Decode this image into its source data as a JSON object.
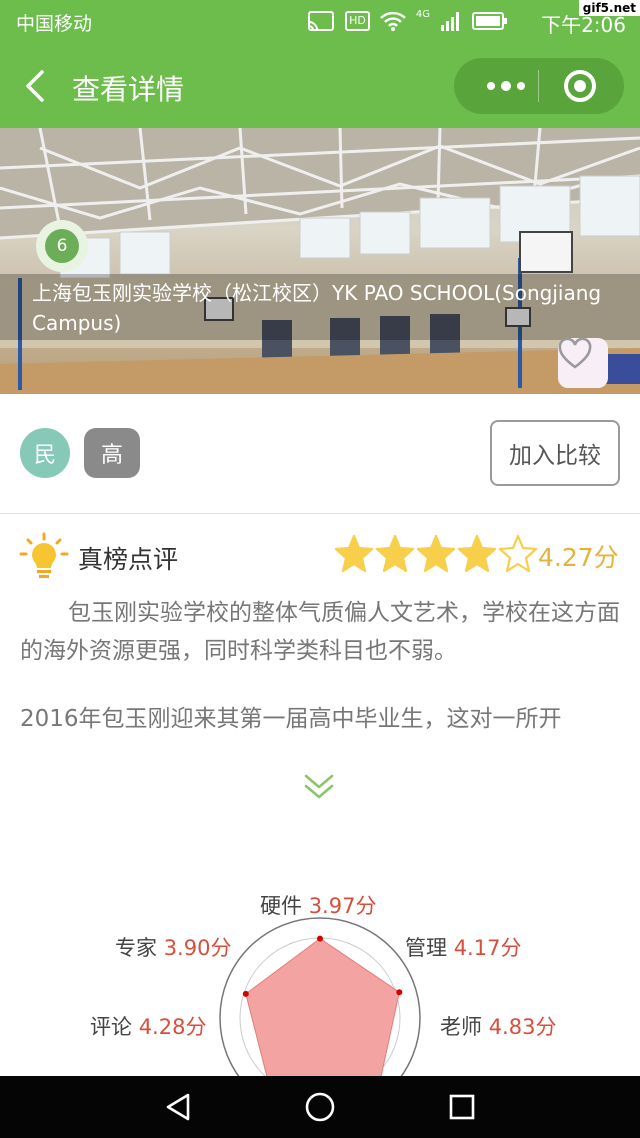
{
  "status_bar": {
    "carrier": "中国移动",
    "hd_badge": "HD",
    "signal_label": "4G",
    "time": "下午2:06",
    "watermark": "gif5.net"
  },
  "navbar": {
    "title": "查看详情",
    "back_icon": "chevron-left-icon",
    "more_icon": "more-dots-icon",
    "close_icon": "target-circle-icon"
  },
  "hero": {
    "rank": "6",
    "school_name": "上海包玉刚实验学校（松江校区）YK PAO SCHOOL(Songjiang Campus)",
    "favorite_icon": "heart-icon"
  },
  "tags": {
    "type": "民",
    "level": "高",
    "compare_label": "加入比较"
  },
  "review": {
    "title": "真榜点评",
    "rating": 4.27,
    "rating_max": 5,
    "score_text": "4.27分",
    "paragraph1": "包玉刚实验学校的整体气质偏人文艺术，学校在这方面的海外资源更强，同时科学类科目也不弱。",
    "paragraph2": "2016年包玉刚迎来其第一届高中毕业生，这对一所开",
    "expand_icon": "double-chevron-down-icon"
  },
  "radar": {
    "axes": [
      {
        "name": "硬件",
        "value": 3.97,
        "text": "3.97分"
      },
      {
        "name": "管理",
        "value": 4.17,
        "text": "4.17分"
      },
      {
        "name": "老师",
        "value": 4.83,
        "text": "4.83分"
      },
      {
        "name": "评论",
        "value": 4.28,
        "text": "4.28分"
      },
      {
        "name": "专家",
        "value": 3.9,
        "text": "3.90分"
      }
    ],
    "max": 5,
    "fill_color": "#f4a3a3",
    "point_color": "#d40000"
  },
  "colors": {
    "brand_green": "#6cbd4b",
    "star_yellow": "#f7cf4a",
    "score_color": "#e8b23a",
    "value_red": "#d74e3c"
  }
}
